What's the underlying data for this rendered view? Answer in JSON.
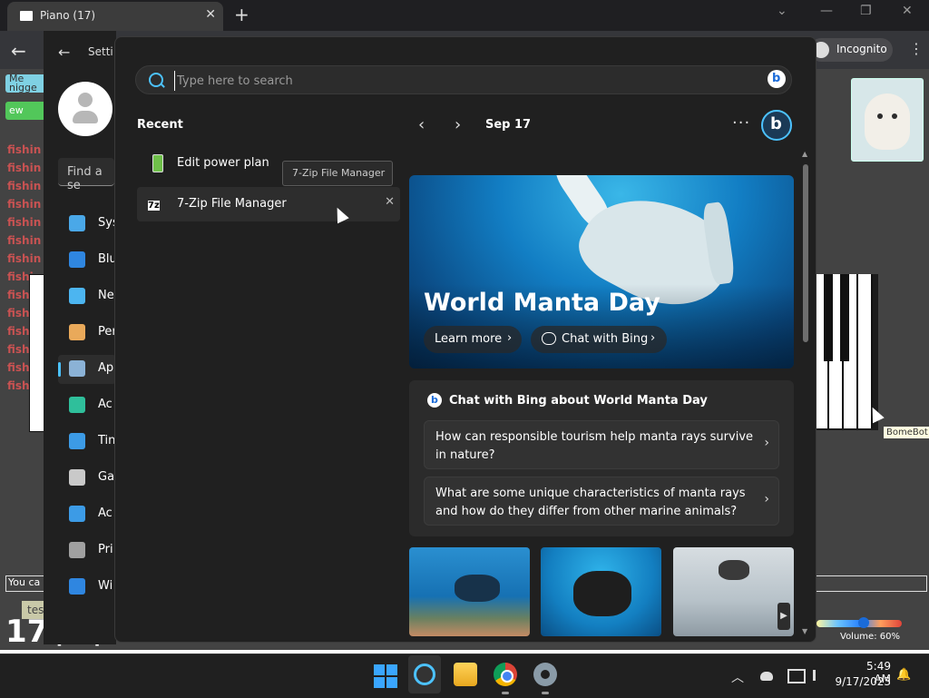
{
  "browser": {
    "tab_title": "Piano (17)",
    "tab_close": "✕",
    "new_tab": "+",
    "back": "←",
    "incognito_label": "Incognito",
    "menu": "⋮",
    "window_controls": [
      "⌄",
      "—",
      "❐",
      "✕"
    ]
  },
  "page": {
    "chat_badges": [
      {
        "text": "Me\nnigge",
        "color": "#7fd1e3"
      },
      {
        "text": "ew",
        "color": "#52c75a"
      }
    ],
    "chat_lines": [
      "fishin",
      "fishin",
      "fishin",
      "fishin",
      "fishin",
      "fishin",
      "fishin",
      "fishin",
      "fishin",
      "fishin",
      "fishin",
      "fishin",
      "fishin",
      "fishin"
    ],
    "chat_input_text": "You ca",
    "room_chip": "test/fishing",
    "people_count": "17",
    "people_label": "peopl",
    "bome_label": "BomeBot",
    "volume_text": "Volume: 60%",
    "volume_value": 0.6
  },
  "settings": {
    "back": "←",
    "title": "Setti",
    "find_placeholder": "Find a se",
    "nav": [
      {
        "label": "Sys",
        "icon": "system-icon",
        "color": "#4aa8e8"
      },
      {
        "label": "Blu",
        "icon": "bluetooth-icon",
        "color": "#2f86e0"
      },
      {
        "label": "Ne",
        "icon": "wifi-icon",
        "color": "#4cb5f0"
      },
      {
        "label": "Per",
        "icon": "brush-icon",
        "color": "#e9a95a"
      },
      {
        "label": "Ap",
        "icon": "apps-icon",
        "color": "#8bb2d6",
        "active": true
      },
      {
        "label": "Ac",
        "icon": "accounts-icon",
        "color": "#2fbf9b"
      },
      {
        "label": "Tin",
        "icon": "time-icon",
        "color": "#3c9be6"
      },
      {
        "label": "Ga",
        "icon": "gaming-icon",
        "color": "#c9c9c9"
      },
      {
        "label": "Ac",
        "icon": "accessibility-icon",
        "color": "#3c9be6"
      },
      {
        "label": "Pri",
        "icon": "privacy-icon",
        "color": "#a0a0a0"
      },
      {
        "label": "Wi",
        "icon": "update-icon",
        "color": "#2f86e0"
      }
    ]
  },
  "search": {
    "placeholder": "Type here to search",
    "recent_heading": "Recent",
    "recent": [
      {
        "label": "Edit power plan",
        "icon": "battery-icon"
      },
      {
        "label": "7-Zip File Manager",
        "icon": "7zip-icon",
        "icon_text": "7z"
      }
    ],
    "recent_close": "✕",
    "tooltip": "7-Zip File Manager",
    "date": "Sep 17",
    "prev": "‹",
    "next": "›",
    "more": "···",
    "hero": {
      "title": "World Manta Day",
      "learn_more": "Learn more",
      "chat_with_bing": "Chat with Bing",
      "chevron": "›"
    },
    "chat_card": {
      "title": "Chat with Bing about World Manta Day",
      "logo": "b",
      "questions": [
        "How can responsible tourism help manta rays survive in nature?",
        "What are some unique characteristics of manta rays and how do they differ from other marine animals?"
      ],
      "chevron": "›"
    },
    "thumb_next": "▶"
  },
  "taskbar": {
    "tray_chevron": "︿",
    "time": "5:49 AM",
    "date": "9/17/2023",
    "notification": "🔔"
  },
  "colors": {
    "accent": "#4cc2ff",
    "panel_bg": "#202020",
    "taskbar_bg": "#202020"
  }
}
